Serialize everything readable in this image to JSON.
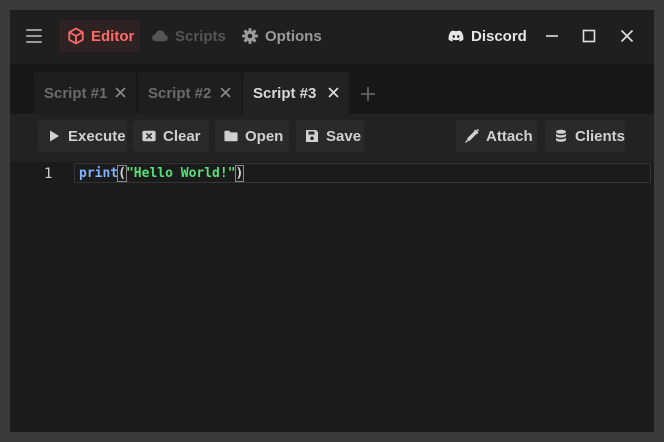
{
  "titlebar": {
    "nav": {
      "editor": "Editor",
      "scripts": "Scripts",
      "options": "Options"
    },
    "discord": "Discord"
  },
  "tabs": [
    {
      "label": "Script #1",
      "active": false
    },
    {
      "label": "Script #2",
      "active": false
    },
    {
      "label": "Script #3",
      "active": true
    }
  ],
  "toolbar": {
    "execute": "Execute",
    "clear": "Clear",
    "open": "Open",
    "save": "Save",
    "attach": "Attach",
    "clients": "Clients"
  },
  "editor": {
    "line_number": "1",
    "code": {
      "function": "print",
      "open_paren": "(",
      "string": "\"Hello World!\"",
      "close_paren": ")"
    }
  },
  "icons": {
    "hamburger": "menu-icon",
    "editor": "cube-icon",
    "scripts": "cloud-icon",
    "options": "gear-icon",
    "discord": "discord-icon",
    "minimize": "minimize-icon",
    "maximize": "maximize-icon",
    "close": "close-icon",
    "add_tab": "plus-icon",
    "execute": "play-icon",
    "clear": "clear-icon",
    "open": "folder-icon",
    "save": "floppy-icon",
    "attach": "syringe-icon",
    "clients": "database-icon"
  },
  "colors": {
    "accent": "#ff6b6b",
    "background": "#1b1b1b",
    "string": "#55e078",
    "function": "#7fb2ff"
  }
}
